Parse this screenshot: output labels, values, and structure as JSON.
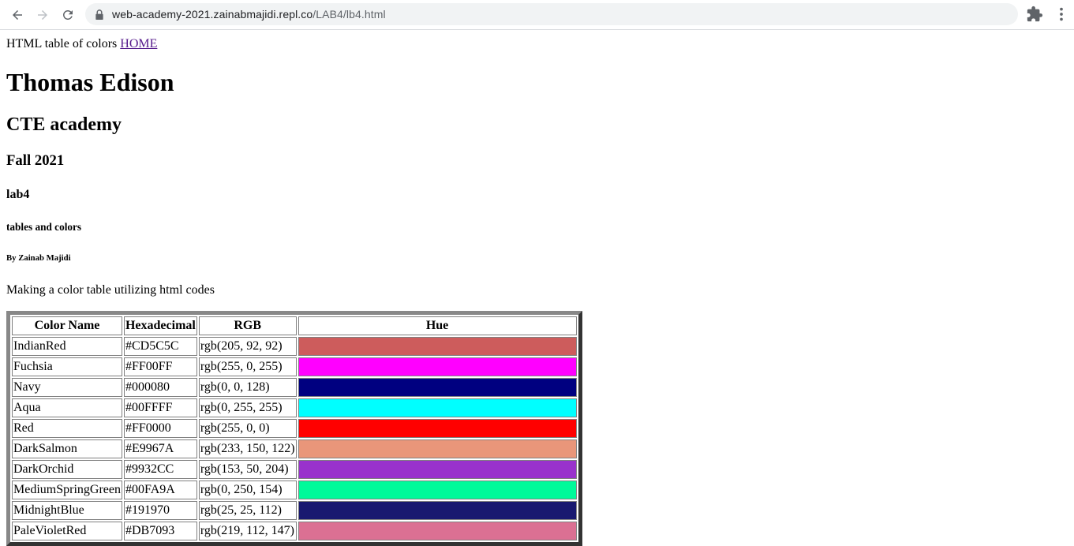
{
  "browser": {
    "url_host": "web-academy-2021.zainabmajidi.repl.co",
    "url_path": "/LAB4/lb4.html"
  },
  "page": {
    "intro_text": "HTML table of colors ",
    "home_link": "HOME",
    "h1": "Thomas Edison",
    "h2": "CTE academy",
    "h3": "Fall 2021",
    "h4": "lab4",
    "h5": "tables and colors",
    "h6": "By Zainab Majidi",
    "description": "Making a color table utilizing html codes"
  },
  "table": {
    "headers": [
      "Color Name",
      "Hexadecimal",
      "RGB",
      "Hue"
    ],
    "rows": [
      {
        "name": "IndianRed",
        "hex": "#CD5C5C",
        "rgb": "rgb(205, 92, 92)",
        "color": "#CD5C5C"
      },
      {
        "name": "Fuchsia",
        "hex": "#FF00FF",
        "rgb": "rgb(255, 0, 255)",
        "color": "#FF00FF"
      },
      {
        "name": "Navy",
        "hex": "#000080",
        "rgb": "rgb(0, 0, 128)",
        "color": "#000080"
      },
      {
        "name": "Aqua",
        "hex": "#00FFFF",
        "rgb": "rgb(0, 255, 255)",
        "color": "#00FFFF"
      },
      {
        "name": "Red",
        "hex": "#FF0000",
        "rgb": "rgb(255, 0, 0)",
        "color": "#FF0000"
      },
      {
        "name": "DarkSalmon",
        "hex": "#E9967A",
        "rgb": "rgb(233, 150, 122)",
        "color": "#E9967A"
      },
      {
        "name": "DarkOrchid",
        "hex": "#9932CC",
        "rgb": "rgb(153, 50, 204)",
        "color": "#9932CC"
      },
      {
        "name": "MediumSpringGreen",
        "hex": "#00FA9A",
        "rgb": "rgb(0, 250, 154)",
        "color": "#00FA9A"
      },
      {
        "name": "MidnightBlue",
        "hex": "#191970",
        "rgb": "rgb(25, 25, 112)",
        "color": "#191970"
      },
      {
        "name": "PaleVioletRed",
        "hex": "#DB7093",
        "rgb": "rgb(219, 112, 147)",
        "color": "#DB7093"
      }
    ]
  }
}
